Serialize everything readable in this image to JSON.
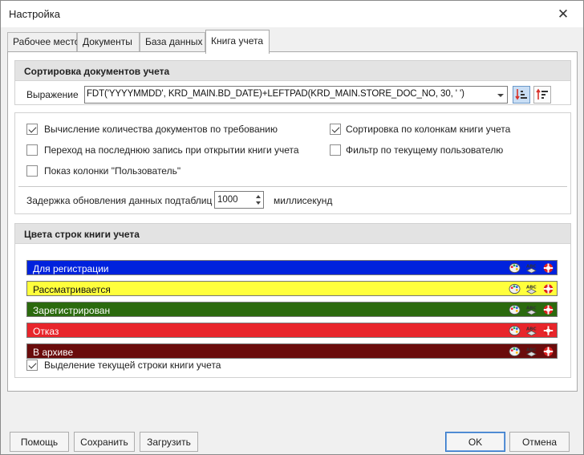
{
  "window": {
    "title": "Настройка"
  },
  "tabs": [
    {
      "label": "Рабочее место",
      "active": false
    },
    {
      "label": "Документы",
      "active": false
    },
    {
      "label": "База данных",
      "active": false
    },
    {
      "label": "Книга учета",
      "active": true
    }
  ],
  "sorting": {
    "header": "Сортировка документов учета",
    "expression_label": "Выражение",
    "expression_value": "FDT('YYYYMMDD', KRD_MAIN.BD_DATE)+LEFTPAD(KRD_MAIN.STORE_DOC_NO, 30, ' ')",
    "sort_asc_icon": "sort-ascending-icon",
    "sort_desc_icon": "sort-descending-icon",
    "sort_asc_pressed": true
  },
  "options": {
    "calc_on_demand": {
      "label": "Вычисление количества документов по требованию",
      "checked": true
    },
    "goto_last": {
      "label": "Переход на последнюю запись при открытии книги учета",
      "checked": false
    },
    "show_user_col": {
      "label": "Показ колонки \"Пользователь\"",
      "checked": false
    },
    "sort_by_columns": {
      "label": "Сортировка по колонкам книги учета",
      "checked": true
    },
    "filter_by_user": {
      "label": "Фильтр по текущему пользователю",
      "checked": false
    },
    "delay": {
      "label": "Задержка обновления данных подтаблиц",
      "value": "1000",
      "unit": "миллисекунд"
    }
  },
  "colors": {
    "header": "Цвета строк книги учета",
    "rows": [
      {
        "label": "Для регистрации",
        "bg": "#0022dd",
        "fg": "#ffffff"
      },
      {
        "label": "Рассматривается",
        "bg": "#ffff3c",
        "fg": "#111111"
      },
      {
        "label": "Зарегистрирован",
        "bg": "#2b6a0e",
        "fg": "#ffffff"
      },
      {
        "label": "Отказ",
        "bg": "#e8252b",
        "fg": "#ffffff"
      },
      {
        "label": "В архиве",
        "bg": "#6a0c0c",
        "fg": "#ffffff"
      }
    ],
    "row_icons": [
      "palette-icon",
      "text-color-icon",
      "reset-lifebuoy-icon"
    ],
    "highlight": {
      "label": "Выделение текущей строки книги учета",
      "checked": true
    }
  },
  "buttons": {
    "help": "Помощь",
    "save": "Сохранить",
    "load": "Загрузить",
    "ok": "OK",
    "cancel": "Отмена"
  }
}
